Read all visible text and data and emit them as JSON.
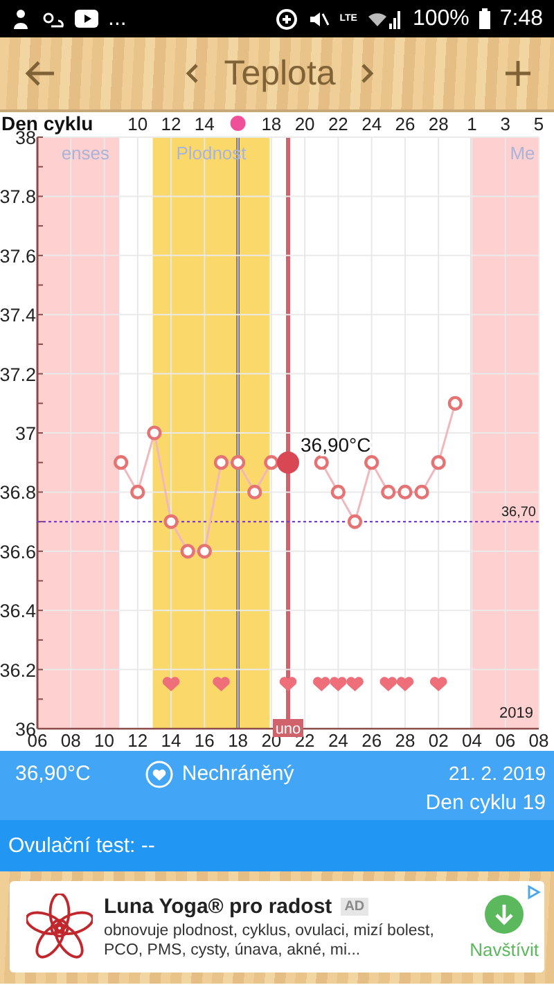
{
  "status_bar": {
    "more": "...",
    "network": "LTE",
    "battery": "100%",
    "time": "7:48"
  },
  "header": {
    "title": "Teplota"
  },
  "cycle_axis": {
    "title": "Den cyklu",
    "ticks": [
      {
        "kind": "number",
        "label": "10"
      },
      {
        "kind": "number",
        "label": "12"
      },
      {
        "kind": "number",
        "label": "14"
      },
      {
        "kind": "ovulation"
      },
      {
        "kind": "number",
        "label": "18"
      },
      {
        "kind": "number",
        "label": "20"
      },
      {
        "kind": "number",
        "label": "22"
      },
      {
        "kind": "number",
        "label": "24"
      },
      {
        "kind": "number",
        "label": "26"
      },
      {
        "kind": "number",
        "label": "28"
      },
      {
        "kind": "number",
        "label": "1"
      },
      {
        "kind": "number",
        "label": "3"
      },
      {
        "kind": "number",
        "label": "5"
      }
    ]
  },
  "chart_data": {
    "type": "line",
    "grid": true,
    "categories": [
      "06",
      null,
      "08",
      null,
      "10",
      null,
      "12",
      null,
      "14",
      null,
      "16",
      null,
      "18",
      null,
      "20",
      null,
      "22",
      null,
      "24",
      null,
      "26",
      null,
      "28",
      null,
      "02",
      null,
      "04",
      null,
      "06",
      null,
      "08"
    ],
    "series": [
      {
        "color": "#e57373",
        "marker": "circle",
        "values": [
          null,
          null,
          null,
          null,
          null,
          36.9,
          36.8,
          37.0,
          36.7,
          36.6,
          36.6,
          36.9,
          36.9,
          36.8,
          36.9,
          36.9,
          null,
          36.9,
          36.8,
          36.7,
          36.9,
          36.8,
          36.8,
          36.8,
          36.9,
          37.1,
          null,
          null,
          null,
          null,
          null
        ]
      }
    ],
    "ylim": [
      36,
      38
    ],
    "yticks": [
      36,
      36.2,
      36.4,
      36.6,
      36.8,
      37,
      37.2,
      37.4,
      37.6,
      37.8,
      38
    ],
    "ref_lines": [
      {
        "axis": "y",
        "value": 36.7,
        "label": "36,70",
        "color": "#7b3fd0"
      }
    ],
    "annotations": [
      {
        "text": "2019"
      }
    ]
  },
  "days": [
    {
      "kind": "menses",
      "label": "enses"
    },
    {
      "kind": "menses"
    },
    {
      "kind": "menses"
    },
    {
      "kind": "menses"
    },
    {
      "kind": "menses"
    },
    {
      "kind": "plain"
    },
    {
      "kind": "plain"
    },
    {
      "kind": "fertile",
      "label": "Plodnost"
    },
    {
      "kind": "fertileheart"
    },
    {
      "kind": "fertile"
    },
    {
      "kind": "fertile"
    },
    {
      "kind": "fertileheart"
    },
    {
      "kind": "ovulation"
    },
    {
      "kind": "fertile"
    },
    {
      "kind": "plain"
    },
    {
      "kind": "selected",
      "tag": "uno",
      "reading": "36,90°C"
    },
    {
      "kind": "plain"
    },
    {
      "kind": "heart"
    },
    {
      "kind": "heart"
    },
    {
      "kind": "heart"
    },
    {
      "kind": "plain"
    },
    {
      "kind": "heart"
    },
    {
      "kind": "heart"
    },
    {
      "kind": "plain"
    },
    {
      "kind": "heart"
    },
    {
      "kind": "plain"
    },
    {
      "kind": "menses",
      "label": "Me"
    },
    {
      "kind": "menses"
    },
    {
      "kind": "menses"
    },
    {
      "kind": "menses"
    },
    {
      "kind": "menses"
    }
  ],
  "day_info": {
    "temperature": "36,90°C",
    "protection": "Nechráněný",
    "date": "21. 2. 2019",
    "cycle_day": "Den cyklu 19"
  },
  "ovulation_test": "Ovulační test: --",
  "ad": {
    "title": "Luna Yoga® pro radost",
    "badge": "AD",
    "text": "obnovuje plodnost, cyklus, ovulaci, mizí bolest, PCO, PMS, cysty, únava, akné, mi...",
    "action": "Navštívit"
  }
}
